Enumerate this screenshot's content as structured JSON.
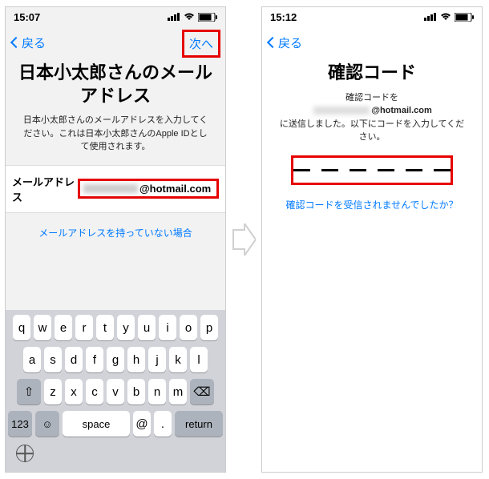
{
  "left": {
    "status_time": "15:07",
    "nav_back": "戻る",
    "nav_next": "次へ",
    "title": "日本小太郎さんのメールアドレス",
    "description": "日本小太郎さんのメールアドレスを入力してください。これは日本小太郎さんのApple IDとして使用されます。",
    "email_label": "メールアドレス",
    "email_domain": "@hotmail.com",
    "no_email_link": "メールアドレスを持っていない場合",
    "keyboard": {
      "row1": [
        "q",
        "w",
        "e",
        "r",
        "t",
        "y",
        "u",
        "i",
        "o",
        "p"
      ],
      "row2": [
        "a",
        "s",
        "d",
        "f",
        "g",
        "h",
        "j",
        "k",
        "l"
      ],
      "row3": [
        "z",
        "x",
        "c",
        "v",
        "b",
        "n",
        "m"
      ],
      "shift": "⇧",
      "delete": "⌫",
      "num": "123",
      "emoji": "☺",
      "space": "space",
      "at": "@",
      "dot": ".",
      "return": "return"
    }
  },
  "right": {
    "status_time": "15:12",
    "nav_back": "戻る",
    "title": "確認コード",
    "desc_line1": "確認コードを",
    "desc_email_domain": "@hotmail.com",
    "desc_line2": "に送信しました。以下にコードを入力してください。",
    "resend_link": "確認コードを受信されませんでしたか？"
  }
}
